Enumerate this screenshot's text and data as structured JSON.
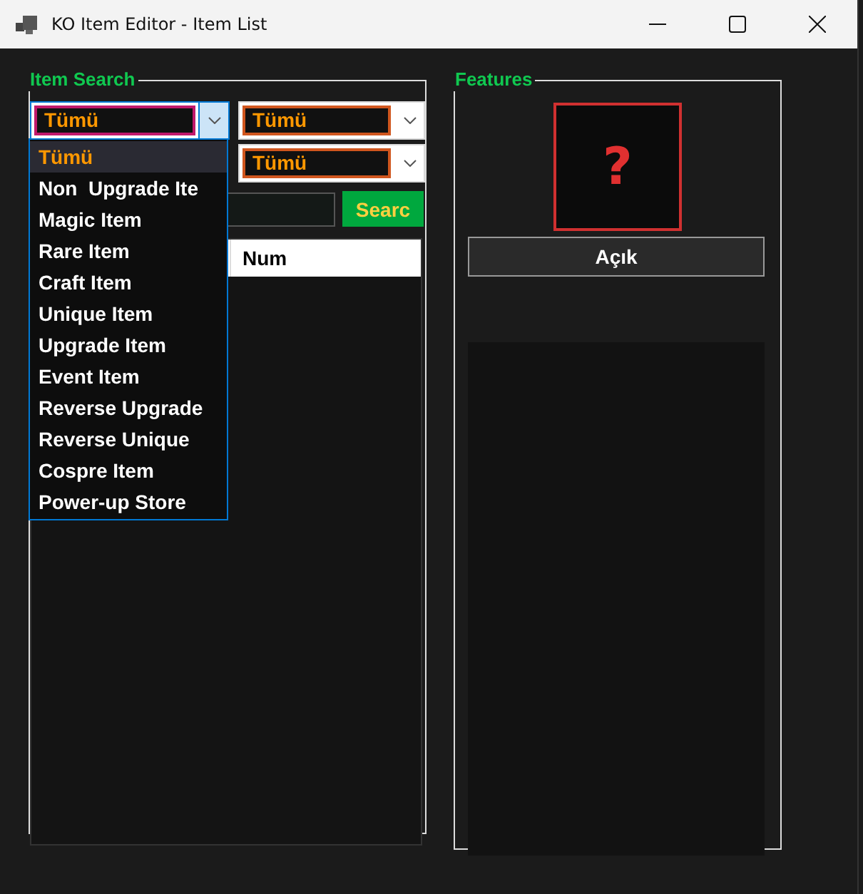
{
  "window": {
    "title": "KO Item Editor - Item List"
  },
  "item_search": {
    "title": "Item Search",
    "combos": [
      {
        "value": "Tümü",
        "expanded": true
      },
      {
        "value": "Tümü",
        "expanded": false
      },
      {
        "value": "Tümü",
        "expanded": false
      }
    ],
    "dropdown": [
      {
        "label": "Tümü",
        "selected": true
      },
      {
        "label": "Non  Upgrade Ite",
        "selected": false
      },
      {
        "label": "Magic Item",
        "selected": false
      },
      {
        "label": "Rare Item",
        "selected": false
      },
      {
        "label": "Craft Item",
        "selected": false
      },
      {
        "label": "Unique Item",
        "selected": false
      },
      {
        "label": "Upgrade Item",
        "selected": false
      },
      {
        "label": "Event Item",
        "selected": false
      },
      {
        "label": "Reverse Upgrade",
        "selected": false
      },
      {
        "label": "Reverse Unique",
        "selected": false
      },
      {
        "label": "Cospre Item",
        "selected": false
      },
      {
        "label": "Power-up Store",
        "selected": false
      }
    ],
    "search_button": "Searc",
    "list_columns": [
      "Num"
    ]
  },
  "features": {
    "title": "Features",
    "image_placeholder": "?",
    "button": "Açık"
  }
}
